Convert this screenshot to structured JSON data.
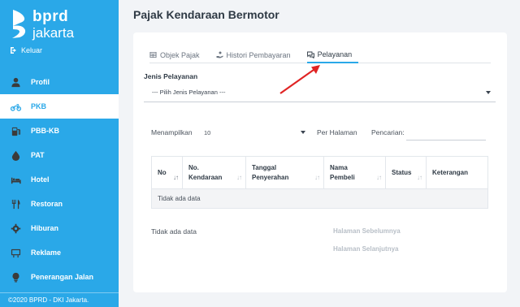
{
  "brand": {
    "line1": "bprd",
    "line2": "jakarta"
  },
  "logout_label": "Keluar",
  "menu": [
    {
      "label": "Profil",
      "icon": "user-icon",
      "active": false
    },
    {
      "label": "PKB",
      "icon": "motorcycle-icon",
      "active": true
    },
    {
      "label": "PBB-KB",
      "icon": "gas-pump-icon",
      "active": false
    },
    {
      "label": "PAT",
      "icon": "water-drop-icon",
      "active": false
    },
    {
      "label": "Hotel",
      "icon": "bed-icon",
      "active": false
    },
    {
      "label": "Restoran",
      "icon": "utensils-icon",
      "active": false
    },
    {
      "label": "Hiburan",
      "icon": "gear-icon",
      "active": false
    },
    {
      "label": "Reklame",
      "icon": "billboard-icon",
      "active": false
    },
    {
      "label": "Penerangan Jalan",
      "icon": "lightbulb-icon",
      "active": false
    }
  ],
  "footer": "©2020 BPRD - DKI Jakarta.",
  "page_title": "Pajak Kendaraan Bermotor",
  "tabs": [
    {
      "label": "Objek Pajak",
      "icon": "table-icon"
    },
    {
      "label": "Histori Pembayaran",
      "icon": "hand-coin-icon"
    },
    {
      "label": "Pelayanan",
      "icon": "chat-icon"
    }
  ],
  "active_tab": "Pelayanan",
  "form": {
    "jenis_label": "Jenis Pelayanan",
    "jenis_value": "--- Pilih Jenis Pelayanan ---"
  },
  "controls": {
    "show_label": "Menampilkan",
    "show_value": "10",
    "per_page_label": "Per Halaman",
    "search_label": "Pencarian:",
    "search_value": ""
  },
  "table": {
    "columns": [
      "No",
      "No. Kendaraan",
      "Tanggal Penyerahan",
      "Nama Pembeli",
      "Status",
      "Keterangan"
    ],
    "empty_text": "Tidak ada data"
  },
  "info_text": "Tidak ada data",
  "pager": {
    "prev": "Halaman Sebelumnya",
    "next": "Halaman Selanjutnya"
  },
  "colors": {
    "accent": "#2aa8e8",
    "arrow": "#e02424"
  }
}
